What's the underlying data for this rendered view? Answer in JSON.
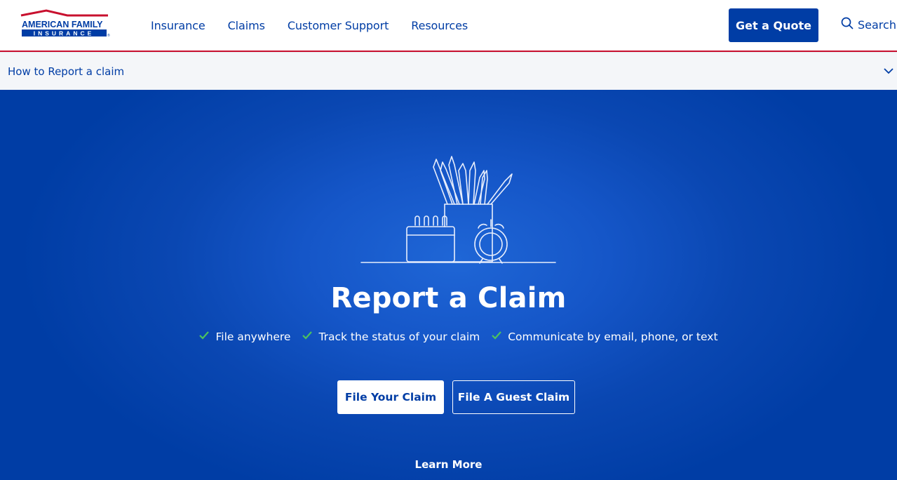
{
  "brand": {
    "name_line1": "AMERICAN FAMILY",
    "name_line2": "INSURANCE",
    "registered": "®",
    "colors": {
      "primary": "#003da5",
      "accent_red": "#c8102e",
      "check_green": "#4cc35e"
    }
  },
  "nav": {
    "items": [
      {
        "label": "Insurance"
      },
      {
        "label": "Claims"
      },
      {
        "label": "Customer Support"
      },
      {
        "label": "Resources"
      }
    ],
    "quote_label": "Get a Quote",
    "search_label": "Search",
    "search_icon": "search-icon"
  },
  "subnav": {
    "label": "How to Report a claim",
    "icon": "chevron-down-icon"
  },
  "hero": {
    "illustration": "desk-pencils-calendar-clock-illustration",
    "title": "Report a Claim",
    "features": [
      {
        "icon": "check-icon",
        "label": "File anywhere"
      },
      {
        "icon": "check-icon",
        "label": "Track the status of your claim"
      },
      {
        "icon": "check-icon",
        "label": "Communicate by email, phone, or text"
      }
    ],
    "primary_button": "File Your Claim",
    "secondary_button": "File A Guest Claim",
    "learn_more": "Learn More"
  }
}
